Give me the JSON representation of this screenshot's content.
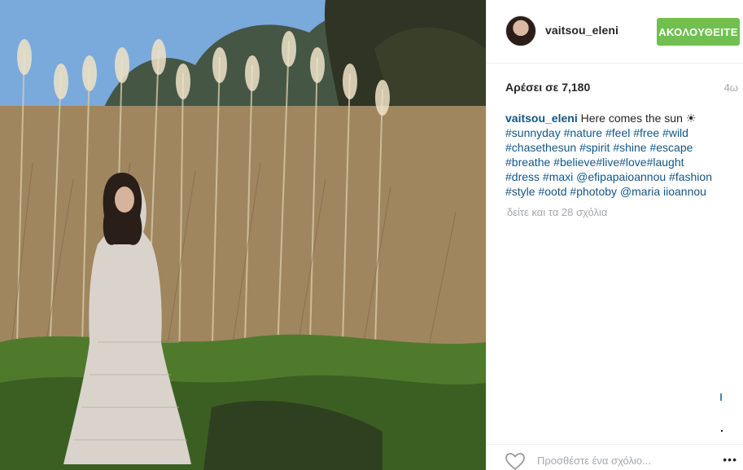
{
  "post": {
    "image_alt": "Photo: woman in a long white lace dress standing among tall pampas grass"
  },
  "header": {
    "username": "vaitsou_eleni",
    "follow_label": "ΑΚΟΛΟΥΘΕΙΤΕ"
  },
  "stats": {
    "likes_text": "Αρέσει σε 7,180",
    "time_ago": "4ω"
  },
  "caption": {
    "username": "vaitsou_eleni",
    "text": "Here comes the sun ☀",
    "tags": [
      "#sunnyday",
      "#nature",
      "#feel",
      "#free",
      "#wild",
      "#chasethesun",
      "#spirit",
      "#shine",
      "#escape",
      "#breathe",
      "#believe#live#love#laught",
      "#dress",
      "#maxi",
      "@efipapaioannou",
      "#fashion",
      "#style",
      "#ootd",
      "#photoby",
      "@maria",
      "iioannou"
    ]
  },
  "comments": {
    "view_all_label": "δείτε και τα 28 σχόλια"
  },
  "footer": {
    "comment_placeholder": "Προσθέστε ένα σχόλιο...",
    "more_label": "•••"
  },
  "icons": {
    "like": "heart-icon",
    "more": "more-options-icon"
  },
  "colors": {
    "follow_button": "#70c050",
    "link": "#125688",
    "muted": "#a5a7aa"
  }
}
